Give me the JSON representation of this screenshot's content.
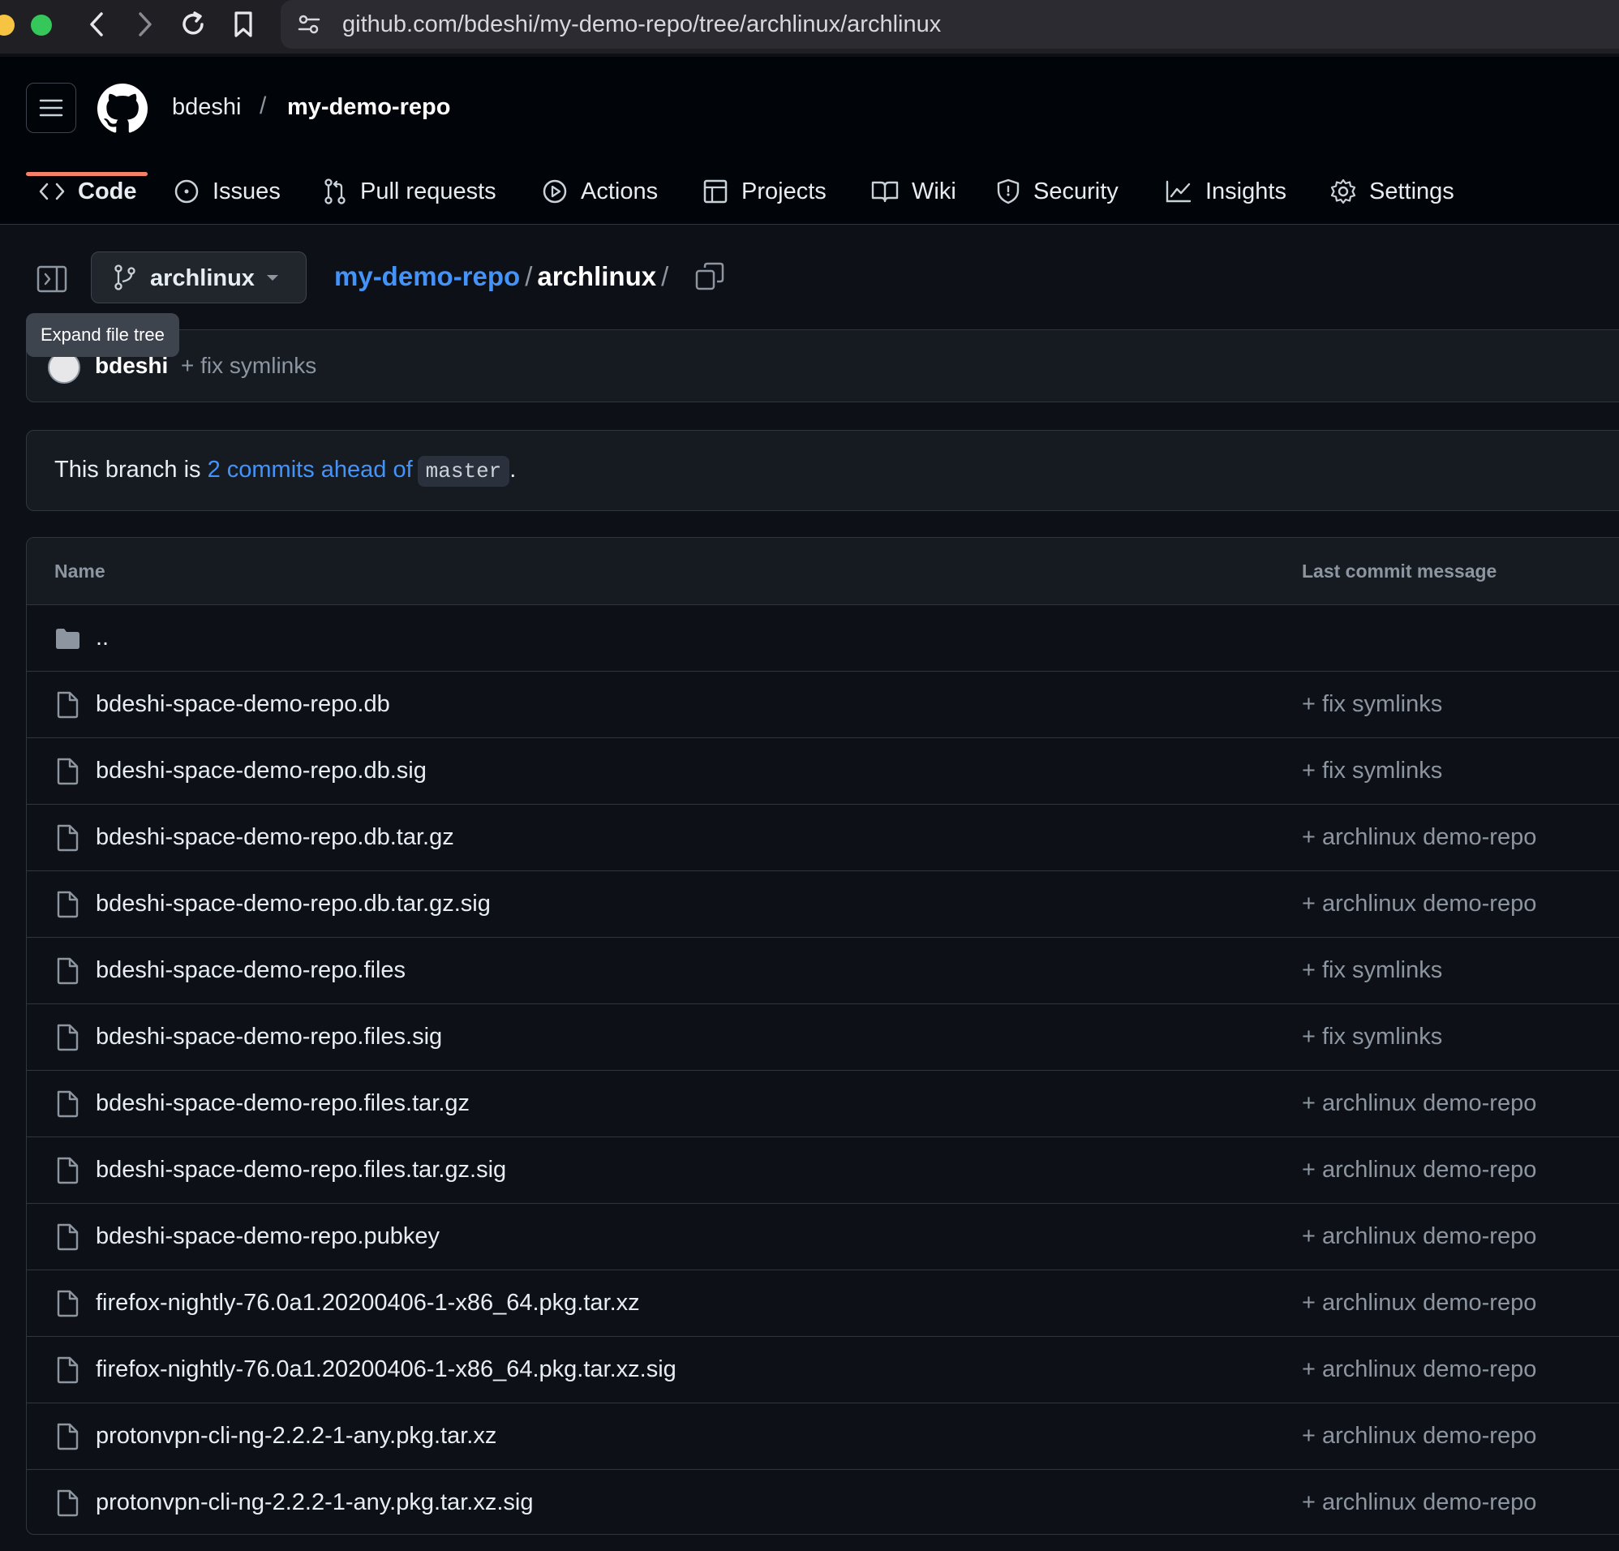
{
  "browser": {
    "url": "github.com/bdeshi/my-demo-repo/tree/archlinux/archlinux"
  },
  "header": {
    "owner": "bdeshi",
    "separator": "/",
    "repo": "my-demo-repo"
  },
  "tabs": [
    {
      "label": "Code",
      "icon": "code-icon",
      "active": true
    },
    {
      "label": "Issues",
      "icon": "issue-icon"
    },
    {
      "label": "Pull requests",
      "icon": "pull-request-icon"
    },
    {
      "label": "Actions",
      "icon": "play-icon"
    },
    {
      "label": "Projects",
      "icon": "table-icon"
    },
    {
      "label": "Wiki",
      "icon": "book-icon"
    },
    {
      "label": "Security",
      "icon": "shield-icon"
    },
    {
      "label": "Insights",
      "icon": "graph-icon"
    },
    {
      "label": "Settings",
      "icon": "gear-icon"
    }
  ],
  "toolbar": {
    "branch": "archlinux",
    "path_repo": "my-demo-repo",
    "path_sep": "/",
    "path_dir": "archlinux",
    "path_trailing": "/",
    "tooltip": "Expand file tree"
  },
  "latest_commit": {
    "author": "bdeshi",
    "message": "+ fix symlinks"
  },
  "ahead": {
    "prefix": "This branch is ",
    "link": "2 commits ahead of",
    "base": "master",
    "suffix": "."
  },
  "table": {
    "col_name": "Name",
    "col_message": "Last commit message",
    "parent": "..",
    "rows": [
      {
        "name": "bdeshi-space-demo-repo.db",
        "message": "+ fix symlinks"
      },
      {
        "name": "bdeshi-space-demo-repo.db.sig",
        "message": "+ fix symlinks"
      },
      {
        "name": "bdeshi-space-demo-repo.db.tar.gz",
        "message": "+ archlinux demo-repo"
      },
      {
        "name": "bdeshi-space-demo-repo.db.tar.gz.sig",
        "message": "+ archlinux demo-repo"
      },
      {
        "name": "bdeshi-space-demo-repo.files",
        "message": "+ fix symlinks"
      },
      {
        "name": "bdeshi-space-demo-repo.files.sig",
        "message": "+ fix symlinks"
      },
      {
        "name": "bdeshi-space-demo-repo.files.tar.gz",
        "message": "+ archlinux demo-repo"
      },
      {
        "name": "bdeshi-space-demo-repo.files.tar.gz.sig",
        "message": "+ archlinux demo-repo"
      },
      {
        "name": "bdeshi-space-demo-repo.pubkey",
        "message": "+ archlinux demo-repo"
      },
      {
        "name": "firefox-nightly-76.0a1.20200406-1-x86_64.pkg.tar.xz",
        "message": "+ archlinux demo-repo"
      },
      {
        "name": "firefox-nightly-76.0a1.20200406-1-x86_64.pkg.tar.xz.sig",
        "message": "+ archlinux demo-repo"
      },
      {
        "name": "protonvpn-cli-ng-2.2.2-1-any.pkg.tar.xz",
        "message": "+ archlinux demo-repo"
      },
      {
        "name": "protonvpn-cli-ng-2.2.2-1-any.pkg.tar.xz.sig",
        "message": "+ archlinux demo-repo"
      }
    ]
  },
  "colors": {
    "background": "#0d1117",
    "header": "#010409",
    "link": "#4493f8",
    "active_tab_underline": "#f78166"
  }
}
